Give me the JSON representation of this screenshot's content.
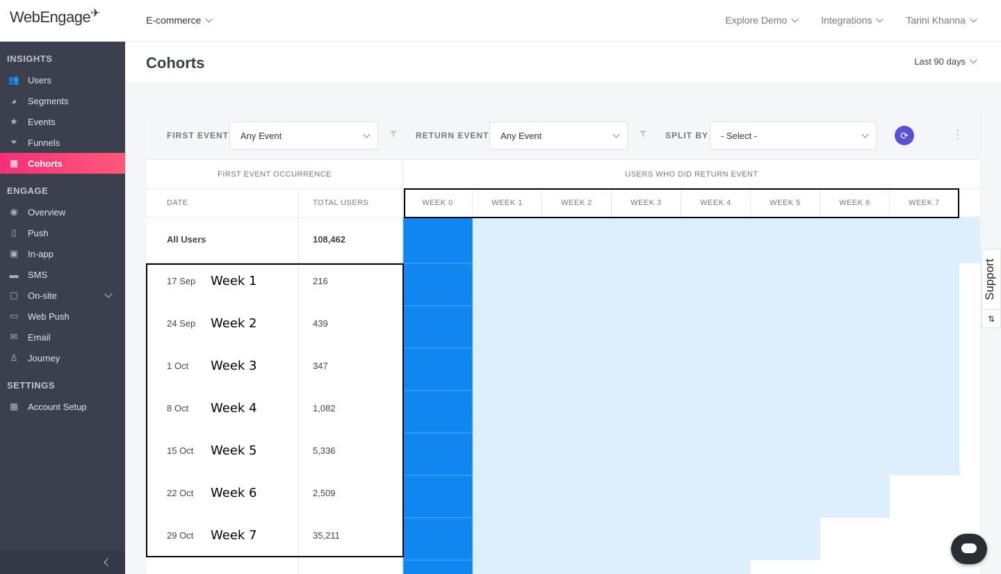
{
  "app": {
    "logo": "WebEngage",
    "project": "E-commerce"
  },
  "topnav": [
    "Explore Demo",
    "Integrations",
    "Tarini Khanna"
  ],
  "sidebar": {
    "sections": [
      {
        "title": "INSIGHTS",
        "items": [
          {
            "label": "Users",
            "icon": "users-icon"
          },
          {
            "label": "Segments",
            "icon": "pie-icon"
          },
          {
            "label": "Events",
            "icon": "star-icon"
          },
          {
            "label": "Funnels",
            "icon": "funnel-icon"
          },
          {
            "label": "Cohorts",
            "icon": "grid-icon",
            "active": true
          }
        ]
      },
      {
        "title": "ENGAGE",
        "items": [
          {
            "label": "Overview",
            "icon": "eye-icon"
          },
          {
            "label": "Push",
            "icon": "mobile-icon"
          },
          {
            "label": "In-app",
            "icon": "inapp-icon"
          },
          {
            "label": "SMS",
            "icon": "chat-icon"
          },
          {
            "label": "On-site",
            "icon": "window-icon",
            "expandable": true
          },
          {
            "label": "Web Push",
            "icon": "webpush-icon"
          },
          {
            "label": "Email",
            "icon": "email-icon"
          },
          {
            "label": "Journey",
            "icon": "journey-icon"
          }
        ]
      },
      {
        "title": "SETTINGS",
        "items": [
          {
            "label": "Account Setup",
            "icon": "apps-icon"
          }
        ]
      }
    ]
  },
  "page": {
    "title": "Cohorts",
    "range": "Last 90 days"
  },
  "filters": {
    "first_event_label": "FIRST EVENT",
    "first_event_value": "Any Event",
    "return_event_label": "RETURN EVENT",
    "return_event_value": "Any Event",
    "split_by_label": "SPLIT BY",
    "split_by_value": "- Select -"
  },
  "table": {
    "group_left": "FIRST EVENT OCCURRENCE",
    "group_right": "USERS WHO DID RETURN EVENT",
    "col_date": "DATE",
    "col_total": "TOTAL USERS",
    "weeks": [
      "WEEK 0",
      "WEEK 1",
      "WEEK 2",
      "WEEK 3",
      "WEEK 4",
      "WEEK 5",
      "WEEK 6",
      "WEEK 7"
    ],
    "all_users": {
      "label": "All Users",
      "total": "108,462"
    },
    "rows": [
      {
        "date": "17 Sep",
        "note": "Week 1",
        "total": "216",
        "cells": 8
      },
      {
        "date": "24 Sep",
        "note": "Week 2",
        "total": "439",
        "cells": 8
      },
      {
        "date": "1 Oct",
        "note": "Week 3",
        "total": "347",
        "cells": 8
      },
      {
        "date": "8 Oct",
        "note": "Week 4",
        "total": "1,082",
        "cells": 8
      },
      {
        "date": "15 Oct",
        "note": "Week 5",
        "total": "5,336",
        "cells": 8
      },
      {
        "date": "22 Oct",
        "note": "Week 6",
        "total": "2,509",
        "cells": 7
      },
      {
        "date": "29 Oct",
        "note": "Week 7",
        "total": "35,211",
        "cells": 6
      }
    ]
  },
  "support_label": "Support"
}
